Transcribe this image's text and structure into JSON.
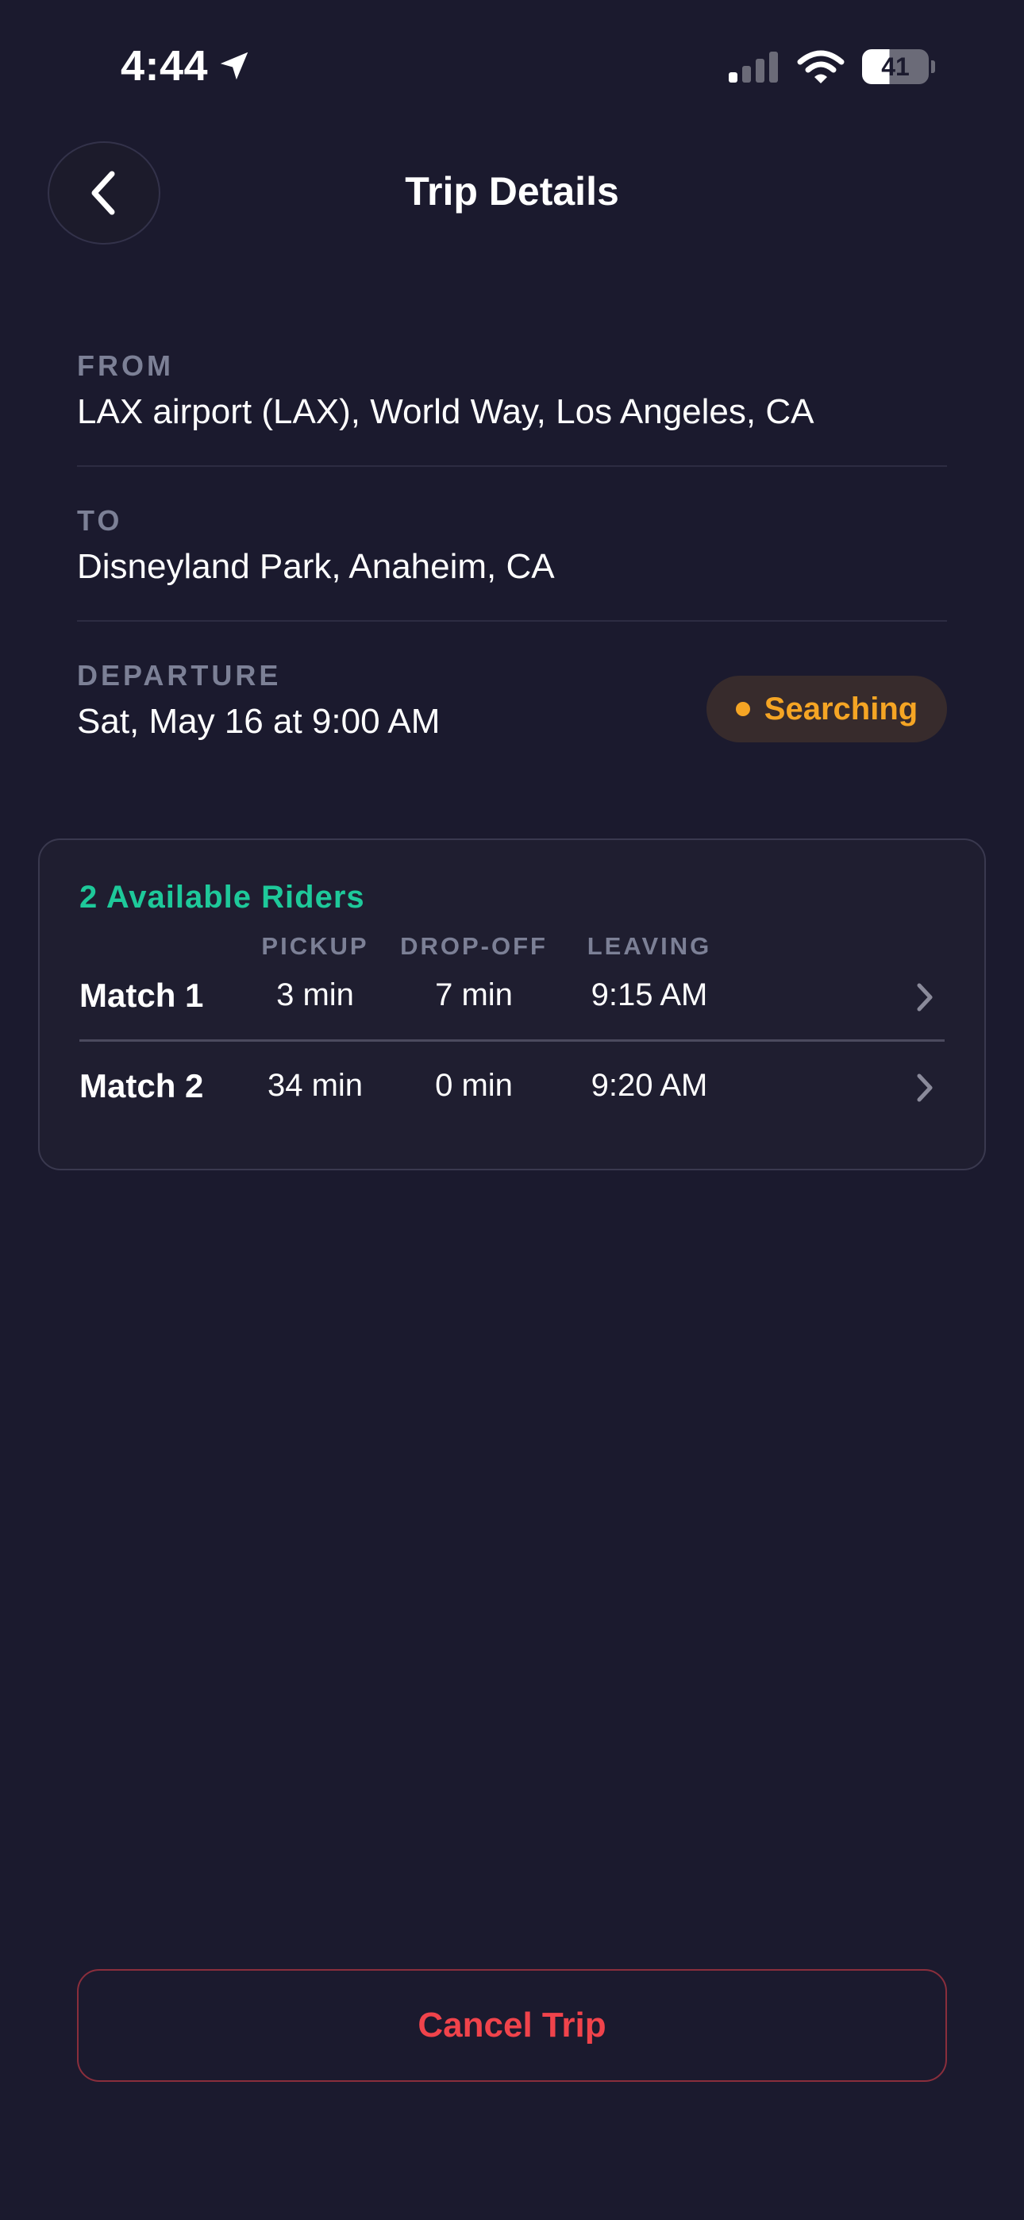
{
  "status_bar": {
    "time": "4:44",
    "battery": "41"
  },
  "header": {
    "title": "Trip Details"
  },
  "trip": {
    "from_label": "FROM",
    "from_value": "LAX airport (LAX), World Way, Los Angeles, CA",
    "to_label": "TO",
    "to_value": "Disneyland Park, Anaheim, CA",
    "departure_label": "DEPARTURE",
    "departure_value": "Sat, May 16 at 9:00 AM",
    "status": "Searching",
    "status_color": "#f5a524"
  },
  "riders": {
    "title": "2 Available Riders",
    "title_color": "#1ec99a",
    "columns": [
      "PICKUP",
      "DROP-OFF",
      "LEAVING"
    ],
    "matches": [
      {
        "name": "Match 1",
        "pickup": "3 min",
        "dropoff": "7 min",
        "leaving": "9:15 AM"
      },
      {
        "name": "Match 2",
        "pickup": "34 min",
        "dropoff": "0 min",
        "leaving": "9:20 AM"
      }
    ]
  },
  "actions": {
    "cancel_label": "Cancel Trip",
    "cancel_color": "#f0434b"
  }
}
